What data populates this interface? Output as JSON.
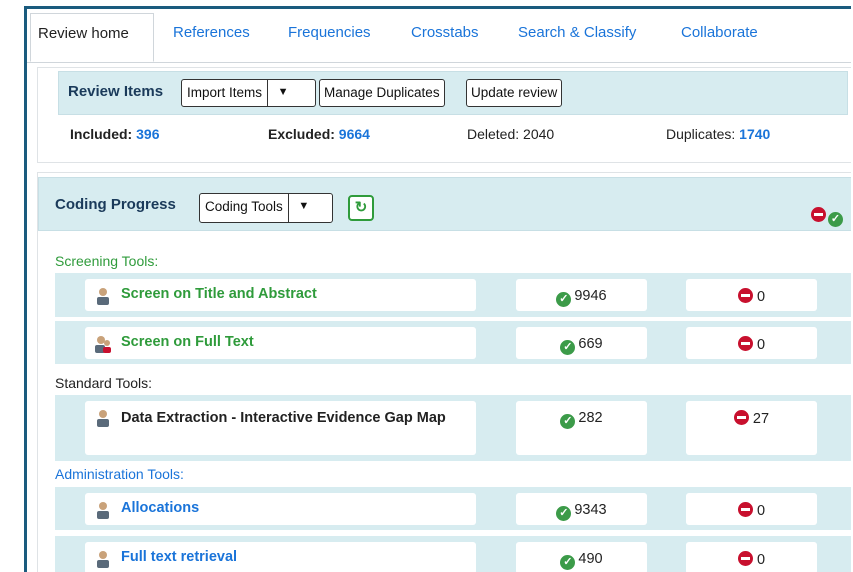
{
  "tabs": [
    "Review home",
    "References",
    "Frequencies",
    "Crosstabs",
    "Search & Classify",
    "Collaborate"
  ],
  "review_items": {
    "title": "Review Items",
    "import_label": "Import Items",
    "manage_label": "Manage Duplicates",
    "update_label": "Update review",
    "included_label": "Included:",
    "included_value": "396",
    "excluded_label": "Excluded:",
    "excluded_value": "9664",
    "deleted_label": "Deleted: 2040",
    "duplicates_label": "Duplicates:",
    "duplicates_value": "1740"
  },
  "coding": {
    "title": "Coding Progress",
    "tools_label": "Coding Tools",
    "refresh_icon": "refresh-icon",
    "sections": {
      "screening": "Screening Tools:",
      "standard": "Standard Tools:",
      "admin": "Administration Tools:"
    },
    "rows": [
      {
        "name": "Screen on Title and Abstract",
        "pos": "9946",
        "neg": "0"
      },
      {
        "name": "Screen on Full Text",
        "pos": "669",
        "neg": "0"
      },
      {
        "name": "Data Extraction - Interactive Evidence Gap Map",
        "pos": "282",
        "neg": "27"
      },
      {
        "name": "Allocations",
        "pos": "9343",
        "neg": "0"
      },
      {
        "name": "Full text retrieval",
        "pos": "490",
        "neg": "0"
      }
    ]
  },
  "colors": {
    "accent": "#1a74d9",
    "green": "#2f9b3b",
    "red": "#c8102e",
    "bar": "#d7ecf0"
  }
}
